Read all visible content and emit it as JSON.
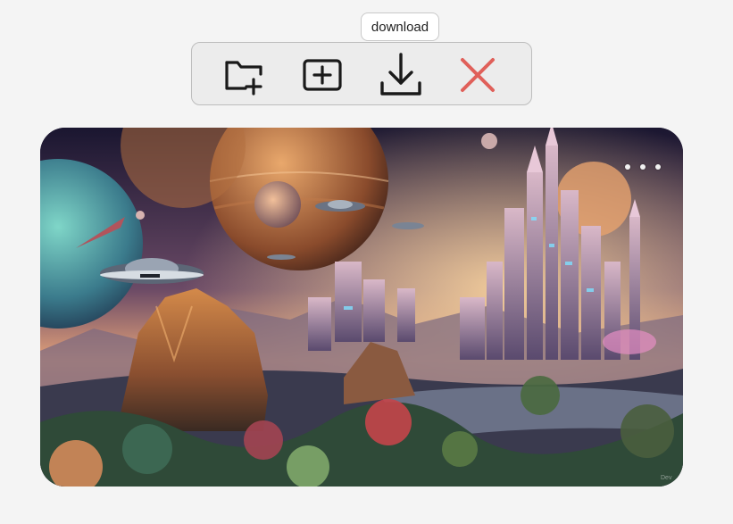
{
  "tooltip": {
    "text": "download"
  },
  "toolbar": {
    "buttons": [
      {
        "id": "new-folder",
        "icon": "folder-plus-icon"
      },
      {
        "id": "add",
        "icon": "plus-square-icon"
      },
      {
        "id": "download",
        "icon": "download-icon"
      },
      {
        "id": "close",
        "icon": "close-icon"
      }
    ],
    "icon_color": "#1a1a1a",
    "close_color": "#e0605a"
  },
  "image": {
    "description_icon": "fantasy-city-image",
    "watermark": "Dev"
  },
  "colors": {
    "page_bg": "#f4f4f4",
    "toolbar_bg": "#ececec",
    "toolbar_border": "#bdbdbd"
  }
}
